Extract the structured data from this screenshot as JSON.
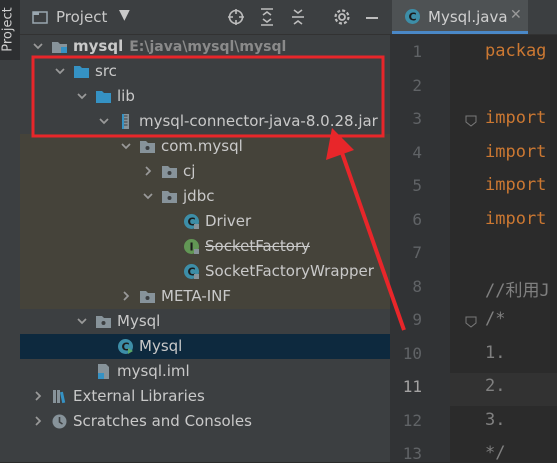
{
  "side_strip": {
    "project_tab_label": "Project"
  },
  "project_panel": {
    "title": "Project",
    "toolbar": [
      "locate-icon",
      "expand-all-icon",
      "collapse-all-icon",
      "settings-icon",
      "hide-icon"
    ]
  },
  "tree": [
    {
      "depth": 0,
      "arrow": "down",
      "icon": "module-folder-icon",
      "label": "mysql",
      "path": "E:\\java\\mysql\\mysql",
      "bold": true
    },
    {
      "depth": 1,
      "arrow": "down",
      "icon": "folder-icon",
      "label": "src"
    },
    {
      "depth": 2,
      "arrow": "down",
      "icon": "folder-icon",
      "label": "lib"
    },
    {
      "depth": 3,
      "arrow": "down",
      "icon": "jar-icon",
      "label": "mysql-connector-java-8.0.28.jar"
    },
    {
      "depth": 4,
      "arrow": "down",
      "icon": "package-icon",
      "label": "com.mysql",
      "lib": true
    },
    {
      "depth": 5,
      "arrow": "right",
      "icon": "package-icon",
      "label": "cj",
      "lib": true
    },
    {
      "depth": 5,
      "arrow": "down",
      "icon": "package-icon",
      "label": "jdbc",
      "lib": true
    },
    {
      "depth": 6,
      "arrow": "none",
      "icon": "class-icon",
      "label": "Driver",
      "lib": true
    },
    {
      "depth": 6,
      "arrow": "none",
      "icon": "interface-icon",
      "label": "SocketFactory",
      "lib": true,
      "strike": true
    },
    {
      "depth": 6,
      "arrow": "none",
      "icon": "class-icon",
      "label": "SocketFactoryWrapper",
      "lib": true
    },
    {
      "depth": 4,
      "arrow": "right",
      "icon": "package-icon",
      "label": "META-INF",
      "lib": true
    },
    {
      "depth": 2,
      "arrow": "down",
      "icon": "package-icon",
      "label": "Mysql"
    },
    {
      "depth": 3,
      "arrow": "none",
      "icon": "run-class-icon",
      "label": "Mysql",
      "selected": true
    },
    {
      "depth": 2,
      "arrow": "none",
      "icon": "iml-file-icon",
      "label": "mysql.iml"
    },
    {
      "depth": 0,
      "arrow": "right",
      "icon": "libraries-icon",
      "label": "External Libraries"
    },
    {
      "depth": 0,
      "arrow": "right",
      "icon": "scratches-icon",
      "label": "Scratches and Consoles"
    }
  ],
  "editor": {
    "tab_label": "Mysql.java",
    "current_line": "11",
    "lines": [
      {
        "n": "1",
        "text": "packag",
        "kind": "kw"
      },
      {
        "n": "2",
        "text": "",
        "kind": ""
      },
      {
        "n": "3",
        "text": "import",
        "kind": "kw"
      },
      {
        "n": "4",
        "text": "import",
        "kind": "kw"
      },
      {
        "n": "5",
        "text": "import",
        "kind": "kw"
      },
      {
        "n": "6",
        "text": "import",
        "kind": "kw"
      },
      {
        "n": "7",
        "text": "",
        "kind": ""
      },
      {
        "n": "8",
        "text": "//利用J",
        "kind": "cm"
      },
      {
        "n": "9",
        "text": "/*",
        "kind": "cm"
      },
      {
        "n": "10",
        "text": "    1.",
        "kind": "cm"
      },
      {
        "n": "11",
        "text": "    2.",
        "kind": "cm"
      },
      {
        "n": "12",
        "text": "    3.",
        "kind": "cm"
      },
      {
        "n": "13",
        "text": "*/",
        "kind": "cm"
      }
    ]
  },
  "colors": {
    "highlight_box": "#e8262a",
    "arrow": "#e8262a",
    "selection": "#0d293e",
    "library_bg": "#45433a"
  }
}
